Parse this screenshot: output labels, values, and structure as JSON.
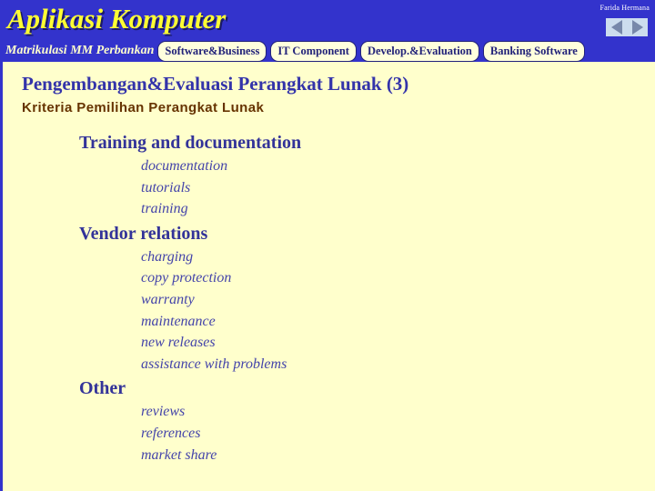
{
  "header": {
    "course_title": "Aplikasi Komputer",
    "author": "Farida Hermana",
    "nav": {
      "prev_icon": "triangle-left-icon",
      "next_icon": "triangle-right-icon"
    },
    "program_label": "Matrikulasi MM Perbankan",
    "tabs": [
      {
        "label": "Software&Business"
      },
      {
        "label": "IT Component"
      },
      {
        "label": "Develop.&Evaluation"
      },
      {
        "label": "Banking Software"
      }
    ]
  },
  "slide": {
    "title": "Pengembangan&Evaluasi Perangkat Lunak (3)",
    "subtitle": "Kriteria Pemilihan Perangkat Lunak",
    "outline": [
      {
        "heading": "Training and documentation",
        "items": [
          "documentation",
          "tutorials",
          "training"
        ]
      },
      {
        "heading": "Vendor relations",
        "items": [
          "charging",
          "copy protection",
          "warranty",
          "maintenance",
          "new releases",
          "assistance with problems"
        ]
      },
      {
        "heading": "Other",
        "items": [
          "reviews",
          "references",
          "market share"
        ]
      }
    ]
  },
  "colors": {
    "header_blue": "#3333cc",
    "title_yellow": "#ffff33",
    "page_background": "#ffffcc",
    "slide_title_blue": "#3333aa",
    "subtitle_brown": "#663300",
    "tab_fill": "#ffffdd",
    "tab_text": "#22227a",
    "nav_box": "#ccddee"
  }
}
